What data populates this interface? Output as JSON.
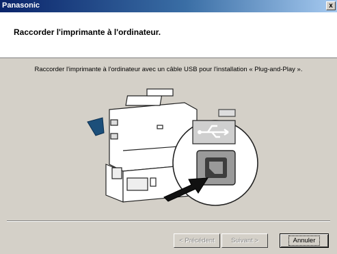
{
  "window": {
    "title": "Panasonic",
    "close_glyph": "x"
  },
  "header": {
    "title": "Raccorder l'imprimante à l'ordinateur."
  },
  "main": {
    "description": "Raccorder l'imprimante à l'ordinateur avec un câble USB pour l'installation « Plug-and-Play ».",
    "illustration_icons": [
      "printer-icon",
      "usb-symbol-icon",
      "usb-port-icon",
      "arrow-icon"
    ]
  },
  "buttons": {
    "prev_label": "< Précédent",
    "next_label": "Suivant >",
    "cancel_label": "Annuler"
  },
  "colors": {
    "titlebar_start": "#0a246a",
    "titlebar_end": "#a6caf0",
    "dialog_face": "#d4d0c8",
    "accent_blue": "#1c4f7a"
  }
}
